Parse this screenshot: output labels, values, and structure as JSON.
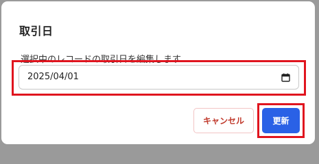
{
  "dialog": {
    "title": "取引日",
    "field_label": "選択中のレコードの取引日を編集します",
    "date_value": "2025/04/01",
    "calendar_icon": "calendar-icon"
  },
  "actions": {
    "cancel_label": "キャンセル",
    "update_label": "更新"
  },
  "colors": {
    "primary": "#2a61e6",
    "cancel_text": "#c0392b",
    "highlight": "#e0141e"
  }
}
